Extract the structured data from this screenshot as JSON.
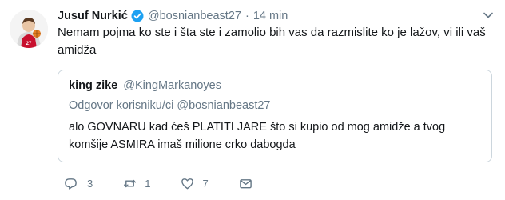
{
  "tweet": {
    "author": {
      "name": "Jusuf Nurkić",
      "handle": "@bosnianbeast27"
    },
    "separator": "·",
    "time": "14 min",
    "text": "Nemam pojma ko ste i šta ste i zamolio bih vas da razmislite ko je lažov, vi ili vaš amidža",
    "quoted": {
      "name": "king zike",
      "handle": "@KingMarkanoyes",
      "reply_to": "Odgovor korisniku/ci @bosnianbeast27",
      "text": "alo GOVNARU kad ćeš PLATITI JARE što si kupio od mog amidže a tvog komšije ASMIRA imaš milione crko dabogda"
    },
    "actions": {
      "replies": "3",
      "retweets": "1",
      "likes": "7"
    }
  },
  "colors": {
    "text": "#14171a",
    "secondary": "#657786",
    "verified": "#1da1f2",
    "border": "#ccd6dd"
  }
}
